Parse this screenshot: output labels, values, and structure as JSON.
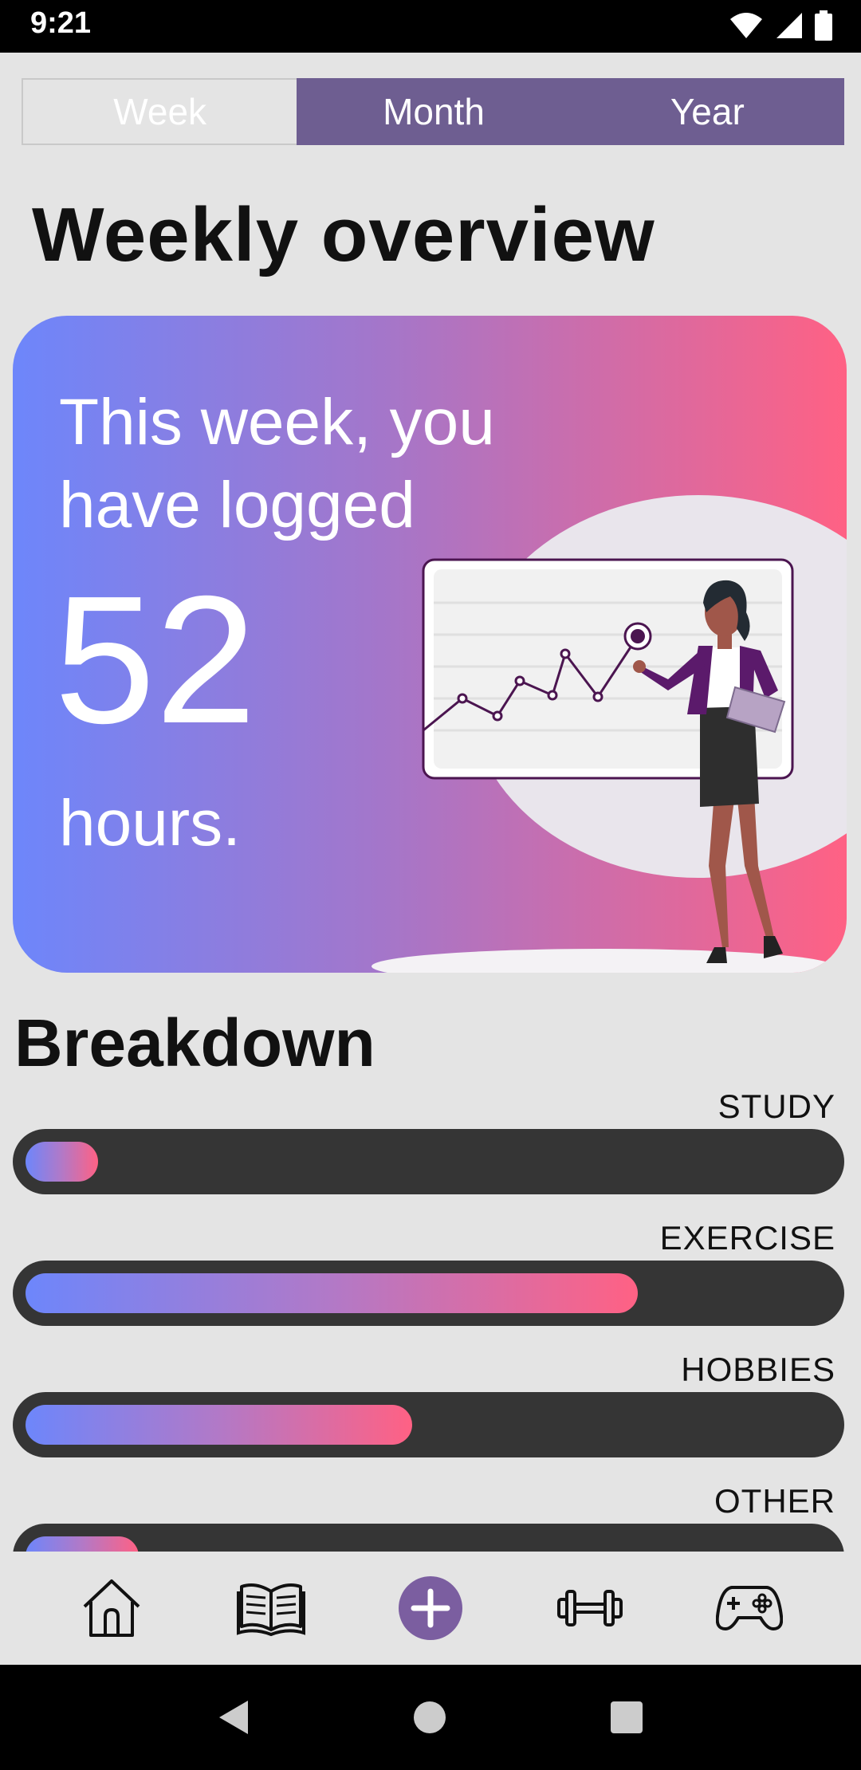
{
  "status_bar": {
    "time": "9:21"
  },
  "tabs": [
    {
      "label": "Week"
    },
    {
      "label": "Month"
    },
    {
      "label": "Year"
    }
  ],
  "page_title": "Weekly overview",
  "hero": {
    "intro": "This week, you have logged",
    "hours": "52",
    "unit": "hours."
  },
  "breakdown": {
    "title": "Breakdown",
    "items": [
      {
        "label": "STUDY",
        "fraction": 0.09
      },
      {
        "label": "EXERCISE",
        "fraction": 0.76
      },
      {
        "label": "HOBBIES",
        "fraction": 0.48
      },
      {
        "label": "OTHER",
        "fraction": 0.14
      }
    ]
  },
  "bottom_nav": {
    "items": [
      {
        "icon": "home-icon"
      },
      {
        "icon": "book-icon"
      },
      {
        "icon": "add-icon"
      },
      {
        "icon": "dumbbell-icon"
      },
      {
        "icon": "gamepad-icon"
      }
    ]
  },
  "colors": {
    "accent": "#6e5e91",
    "gradient_start": "#6d86fb",
    "gradient_end": "#ff6184",
    "bar_track": "#353535"
  }
}
